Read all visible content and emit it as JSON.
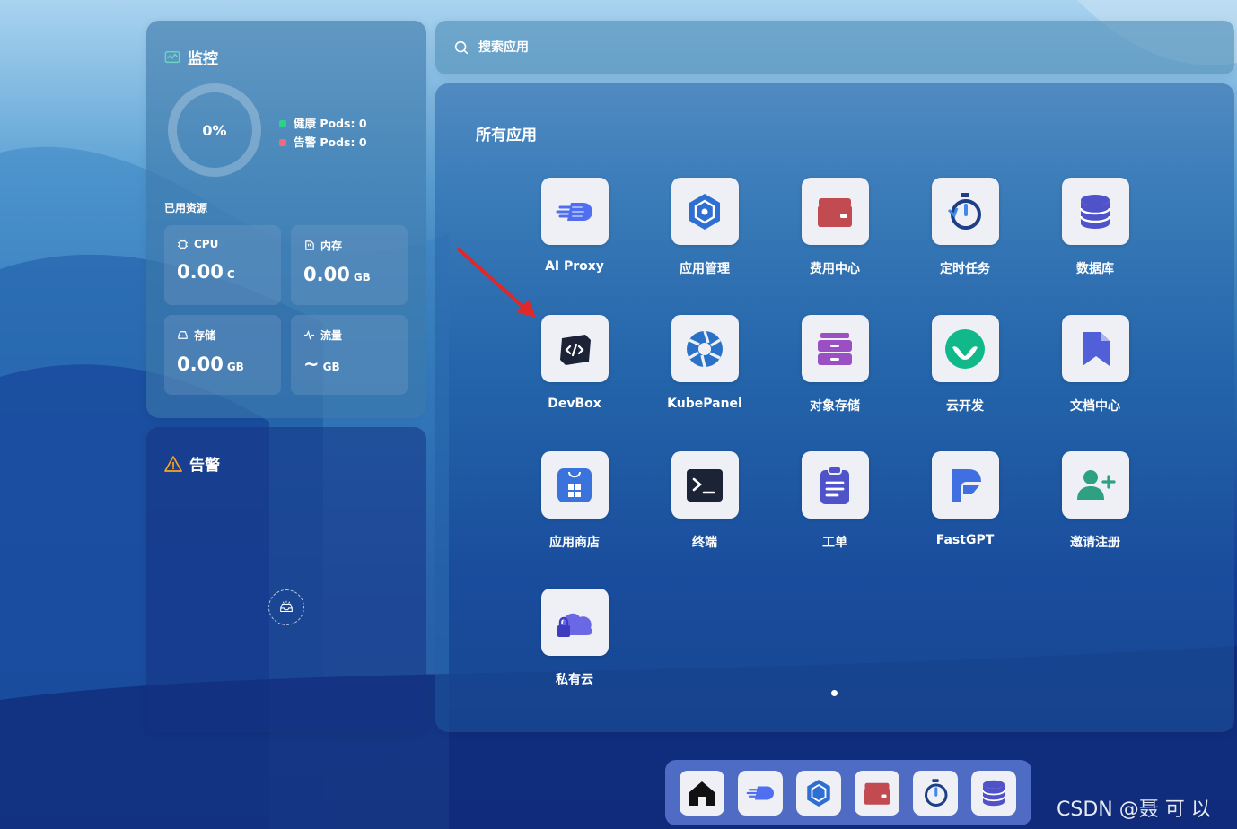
{
  "monitor": {
    "title": "监控",
    "ring_value": "0%",
    "legend": [
      {
        "label": "健康 Pods: 0",
        "color": "#2fd08a"
      },
      {
        "label": "告警 Pods: 0",
        "color": "#f06a7e"
      }
    ],
    "resources_label": "已用资源",
    "resources": [
      {
        "label": "CPU",
        "value": "0.00",
        "unit": "C",
        "icon": "cpu-icon"
      },
      {
        "label": "内存",
        "value": "0.00",
        "unit": "GB",
        "icon": "memory-icon"
      },
      {
        "label": "存储",
        "value": "0.00",
        "unit": "GB",
        "icon": "storage-icon"
      },
      {
        "label": "流量",
        "value": "~",
        "unit": "GB",
        "icon": "traffic-icon"
      }
    ]
  },
  "alerts": {
    "title": "告警"
  },
  "search": {
    "placeholder": "搜索应用"
  },
  "apps": {
    "title": "所有应用",
    "items": [
      {
        "label": "AI Proxy",
        "icon": "ai-proxy-icon"
      },
      {
        "label": "应用管理",
        "icon": "app-manage-icon"
      },
      {
        "label": "费用中心",
        "icon": "wallet-icon"
      },
      {
        "label": "定时任务",
        "icon": "timer-icon"
      },
      {
        "label": "数据库",
        "icon": "database-icon"
      },
      {
        "label": "DevBox",
        "icon": "devbox-icon"
      },
      {
        "label": "KubePanel",
        "icon": "kubepanel-icon"
      },
      {
        "label": "对象存储",
        "icon": "object-storage-icon"
      },
      {
        "label": "云开发",
        "icon": "cloud-dev-icon"
      },
      {
        "label": "文档中心",
        "icon": "docs-icon"
      },
      {
        "label": "应用商店",
        "icon": "app-store-icon"
      },
      {
        "label": "终端",
        "icon": "terminal-icon"
      },
      {
        "label": "工单",
        "icon": "ticket-icon"
      },
      {
        "label": "FastGPT",
        "icon": "fastgpt-icon"
      },
      {
        "label": "邀请注册",
        "icon": "invite-icon"
      },
      {
        "label": "私有云",
        "icon": "private-cloud-icon"
      }
    ]
  },
  "dock": {
    "items": [
      {
        "icon": "home-icon"
      },
      {
        "icon": "ai-proxy-icon"
      },
      {
        "icon": "app-manage-icon"
      },
      {
        "icon": "wallet-icon"
      },
      {
        "icon": "timer-icon"
      },
      {
        "icon": "database-icon"
      }
    ]
  },
  "watermark": "CSDN @聂 可 以",
  "colors": {
    "accent": "#3f6fd8",
    "arrow": "#e0282a"
  }
}
